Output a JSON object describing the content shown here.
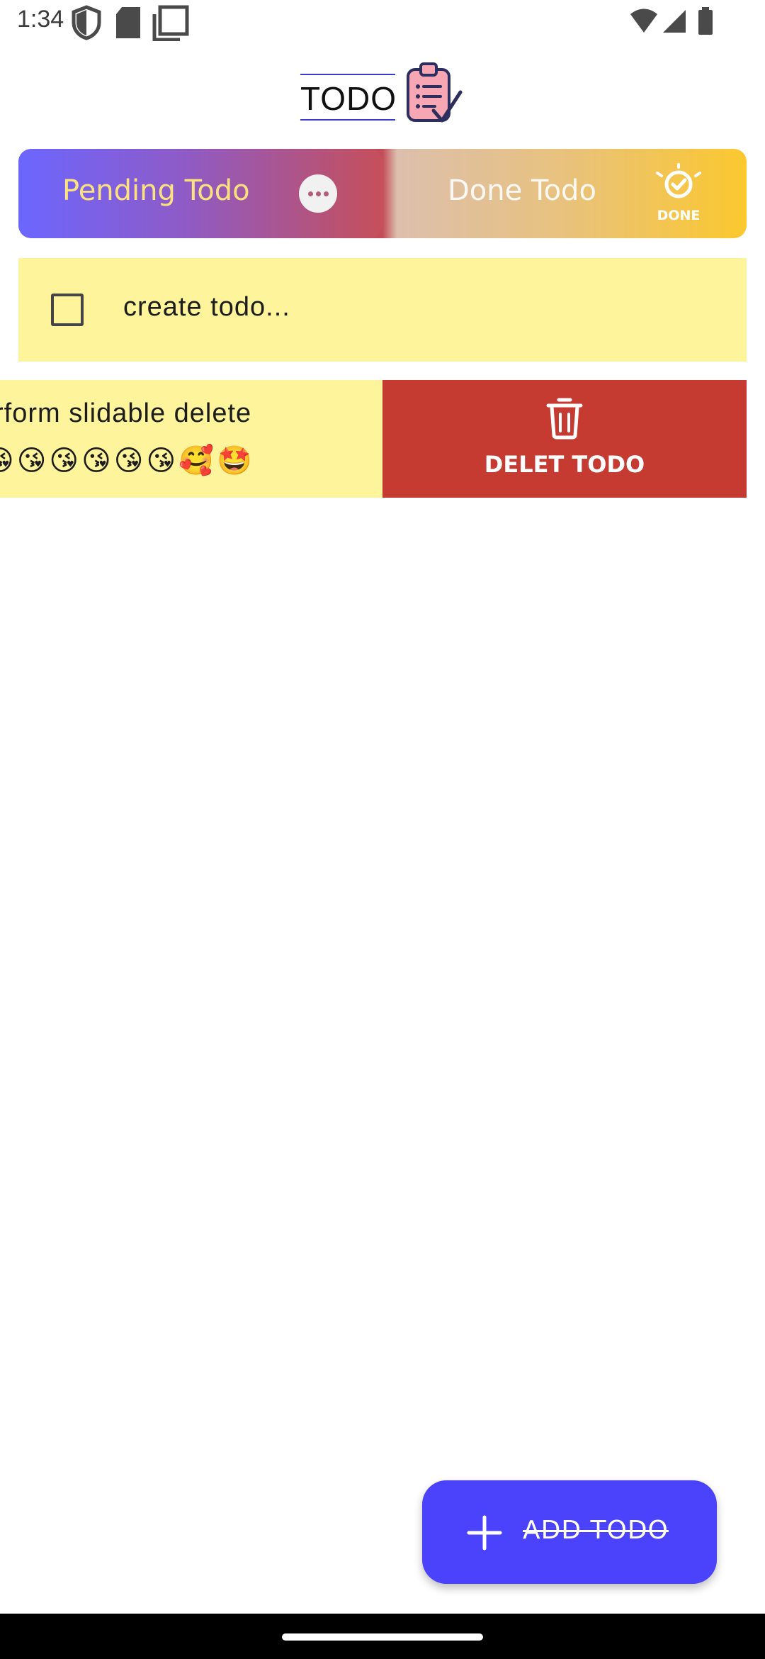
{
  "status_bar": {
    "time": "1:34",
    "icons": [
      "shield-icon",
      "sd-card-icon",
      "screenshot-icon",
      "wifi-icon",
      "signal-icon",
      "battery-icon"
    ]
  },
  "app_bar": {
    "title": "TODO",
    "logo_icon": "clipboard-list-icon"
  },
  "tabs": [
    {
      "label": "Pending Todo",
      "icon": "more-dots-icon",
      "selected": true
    },
    {
      "label": "Done Todo",
      "icon": "done-badge-icon",
      "icon_text": "DONE",
      "selected": false
    }
  ],
  "todos": [
    {
      "text": "create todo...",
      "checked": false
    }
  ],
  "swiped_todo": {
    "text": "rform slidable delete",
    "emojis": "😘😘😘😘😘😘🥰🤩",
    "action_label": "DELET TODO",
    "action_icon": "trash-icon"
  },
  "fab": {
    "label": "ADD TODO",
    "icon": "plus-icon"
  },
  "colors": {
    "todo_bg": "#fef49c",
    "delete_bg": "#c53a31",
    "fab_bg": "#4b43fb",
    "pending_tab_start": "#6c66ff",
    "pending_tab_end": "#c64f5a",
    "done_tab_end": "#fbc82e",
    "pending_label": "#fce27f"
  }
}
